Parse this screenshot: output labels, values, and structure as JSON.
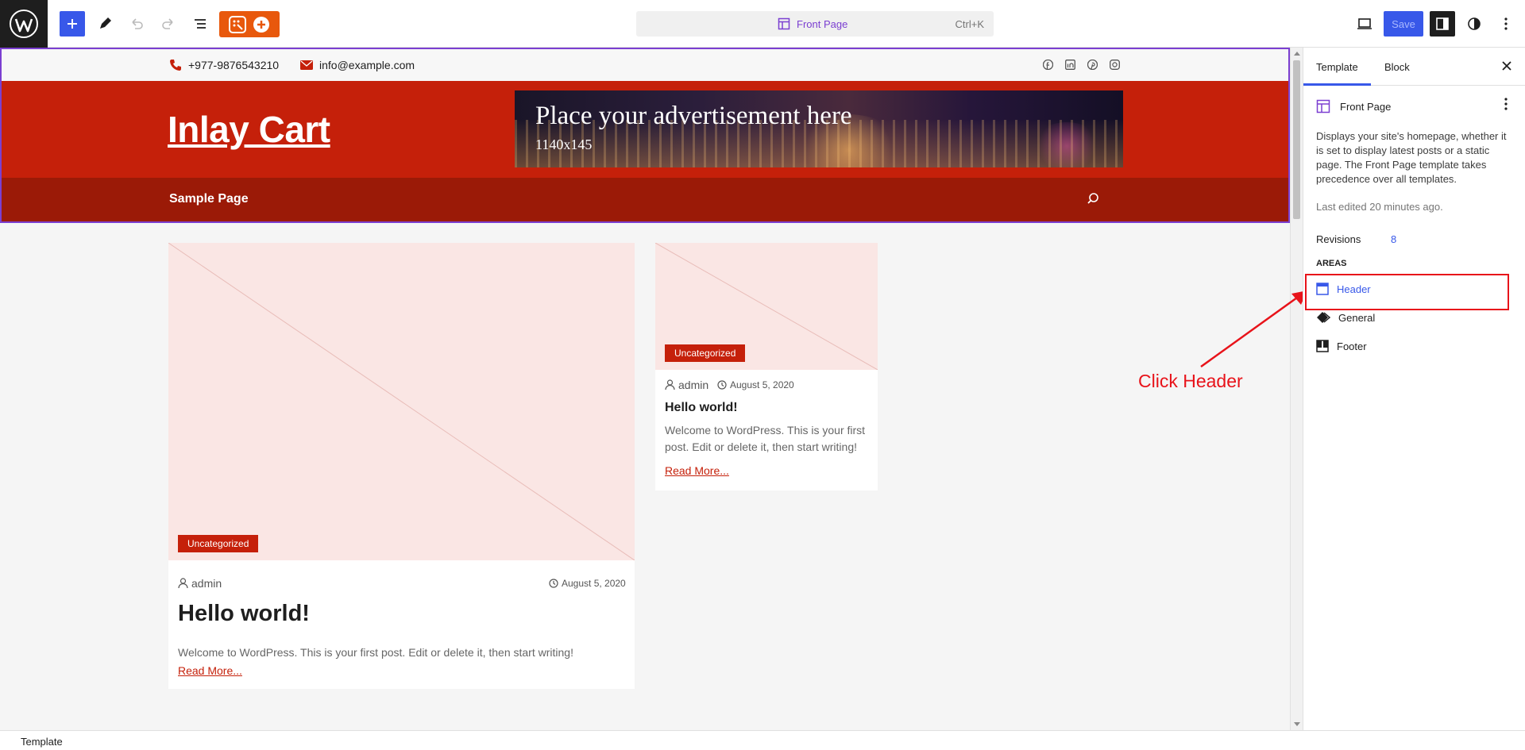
{
  "toolbar": {
    "document_title": "Front Page",
    "shortcut": "Ctrl+K",
    "save_label": "Save"
  },
  "header": {
    "phone": "+977-9876543210",
    "email": "info@example.com",
    "site_title": "Inlay Cart",
    "ad_title": "Place your advertisement here",
    "ad_size": "1140x145",
    "nav_item": "Sample Page",
    "social_icons": [
      "facebook-icon",
      "linkedin-icon",
      "pinterest-icon",
      "instagram-icon"
    ]
  },
  "posts": [
    {
      "category": "Uncategorized",
      "author": "admin",
      "date": "August 5, 2020",
      "title": "Hello world!",
      "excerpt": "Welcome to WordPress. This is your first post. Edit or delete it, then start writing!",
      "read_more": "Read More..."
    },
    {
      "category": "Uncategorized",
      "author": "admin",
      "date": "August 5, 2020",
      "title": "Hello world!",
      "excerpt": "Welcome to WordPress. This is your first post. Edit or delete it, then start writing!",
      "read_more": "Read More..."
    }
  ],
  "annotation": "Click Header",
  "sidebar": {
    "tab_template": "Template",
    "tab_block": "Block",
    "template_name": "Front Page",
    "description": "Displays your site's homepage, whether it is set to display latest posts or a static page. The Front Page template takes precedence over all templates.",
    "last_edited": "Last edited 20 minutes ago.",
    "revisions_label": "Revisions",
    "revisions_count": "8",
    "areas_heading": "AREAS",
    "areas": [
      "Header",
      "General",
      "Footer"
    ]
  },
  "status_bar": "Template",
  "colors": {
    "accent": "#3858e9",
    "brand_red": "#c5200a",
    "nav_red": "#9b1a07",
    "selection_purple": "#7b3fd1",
    "annotation_red": "#e8131a"
  }
}
